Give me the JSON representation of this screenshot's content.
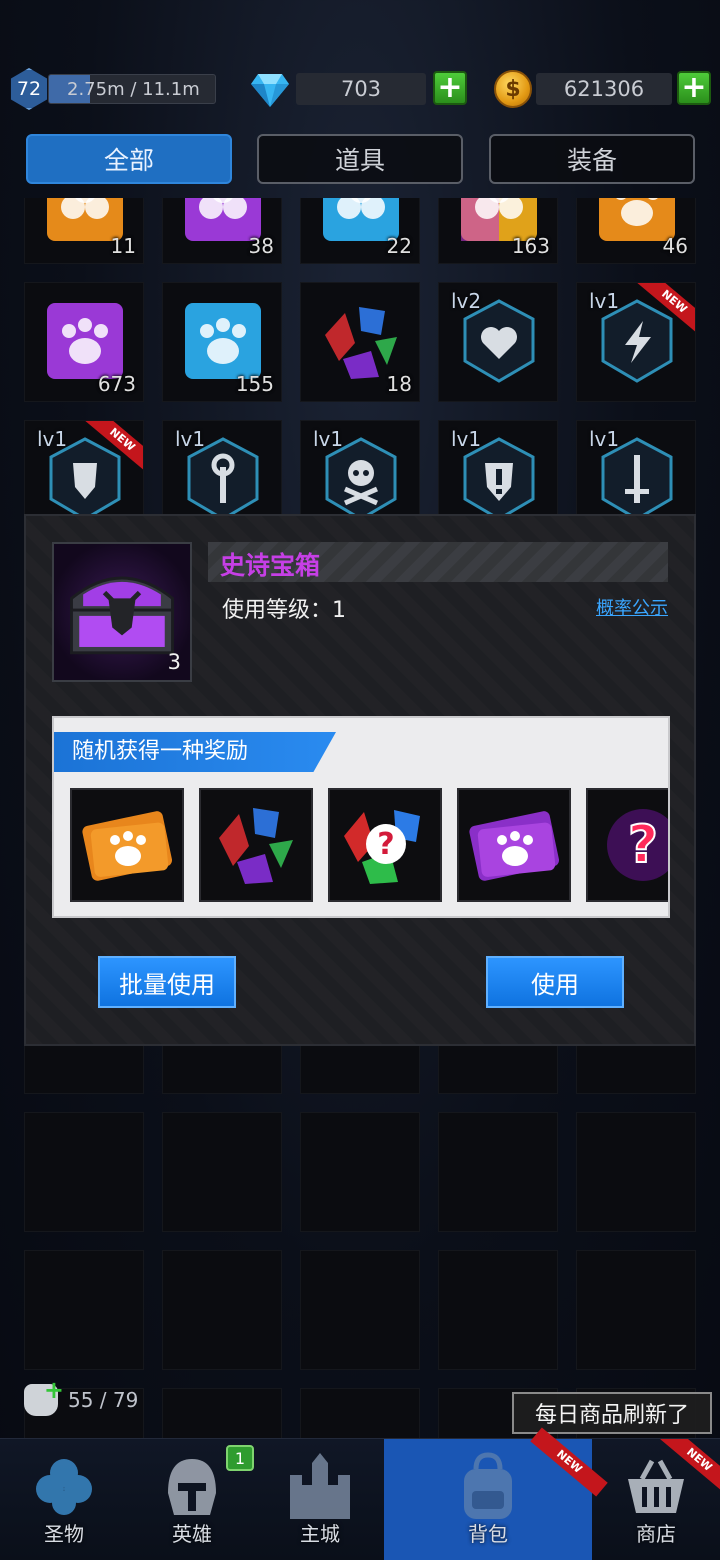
{
  "header": {
    "level": "72",
    "exp_text": "2.75m / 11.1m",
    "exp_progress": 0.248,
    "gems": "703",
    "gold": "621306",
    "gem_icon": "gem-icon",
    "coin_icon": "coin-icon",
    "coin_symbol": "$",
    "plus_symbol": "+"
  },
  "tabs": [
    {
      "label": "全部",
      "active": true
    },
    {
      "label": "道具",
      "active": false
    },
    {
      "label": "装备",
      "active": false
    }
  ],
  "grid": {
    "row1": [
      {
        "count": "11",
        "color": "#e58a1a",
        "icon": "clover-puzzle-icon"
      },
      {
        "count": "38",
        "color": "#9a39d6",
        "icon": "clover-puzzle-icon"
      },
      {
        "count": "22",
        "color": "#2aa3e0",
        "icon": "clover-puzzle-icon"
      },
      {
        "count": "163",
        "color": "#e0a21a",
        "icon": "clover-puzzle-icon"
      },
      {
        "count": "46",
        "color": "#e58a1a",
        "icon": "paw-puzzle-icon"
      }
    ],
    "row2": [
      {
        "count": "673",
        "color": "#9a39d6",
        "icon": "paw-puzzle-icon"
      },
      {
        "count": "155",
        "color": "#2aa3e0",
        "icon": "paw-puzzle-icon"
      },
      {
        "count": "18",
        "color": "#c0282c",
        "icon": "gem-cluster-icon"
      },
      {
        "level": "lv2",
        "icon": "heart-rune-icon",
        "is_new": false
      },
      {
        "level": "lv1",
        "icon": "lightning-rune-icon",
        "is_new": true
      }
    ],
    "row3": [
      {
        "level": "lv1",
        "icon": "shield-rune-icon",
        "is_new": true
      },
      {
        "level": "lv1",
        "icon": "staff-rune-icon",
        "is_new": false
      },
      {
        "level": "lv1",
        "icon": "skull-rune-icon",
        "is_new": false
      },
      {
        "level": "lv1",
        "icon": "exclaim-shield-rune-icon",
        "is_new": false
      },
      {
        "level": "lv1",
        "icon": "sword-rune-icon",
        "is_new": false
      }
    ],
    "new_label": "NEW"
  },
  "item_detail": {
    "name": "史诗宝箱",
    "count": "3",
    "use_level": "使用等级：1",
    "probability_link": "概率公示",
    "reward_header": "随机获得一种奖励",
    "rewards": [
      {
        "icon": "orange-paw-ticket-icon"
      },
      {
        "icon": "gem-cluster-icon"
      },
      {
        "icon": "random-gem-icon"
      },
      {
        "icon": "purple-paw-ticket-icon"
      },
      {
        "icon": "random-reward-icon"
      }
    ],
    "batch_use_label": "批量使用",
    "use_label": "使用",
    "name_color": "#c63fe6"
  },
  "bag": {
    "capacity": "55 / 79"
  },
  "toast": "每日商品刷新了",
  "nav": [
    {
      "label": "圣物",
      "icon": "clover-icon",
      "badge": null,
      "is_new": false
    },
    {
      "label": "英雄",
      "icon": "helmet-icon",
      "badge": "1",
      "is_new": false
    },
    {
      "label": "主城",
      "icon": "castle-icon",
      "badge": null,
      "is_new": false
    },
    {
      "label": "背包",
      "icon": "backpack-icon",
      "badge": null,
      "is_new": true,
      "active": true
    },
    {
      "label": "商店",
      "icon": "shop-basket-icon",
      "badge": null,
      "is_new": true
    }
  ],
  "colors": {
    "accent": "#1f6fc2",
    "nav_active": "#1a56b4",
    "button_blue": "#1f86f2",
    "new_ribbon": "#c4161c"
  }
}
